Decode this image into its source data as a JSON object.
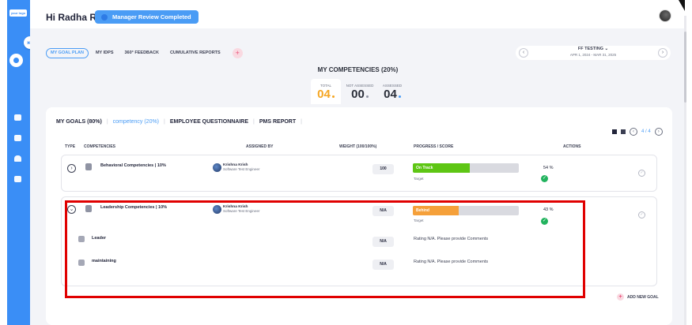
{
  "header": {
    "greeting": "Hi Radha R",
    "review_status": "Manager Review Completed"
  },
  "sidebar": {
    "logo_text": "your logo",
    "items": [
      {
        "icon": "dashboard-icon"
      },
      {
        "icon": "book-icon"
      },
      {
        "icon": "people-icon"
      },
      {
        "icon": "document-icon"
      }
    ]
  },
  "tabs": [
    {
      "label": "MY GOAL PLAN",
      "active": true
    },
    {
      "label": "MY IDPS",
      "active": false
    },
    {
      "label": "360° FEEDBACK",
      "active": false
    },
    {
      "label": "CUMULATIVE REPORTS",
      "active": false
    }
  ],
  "period": {
    "title": "FF TESTING ⌄",
    "range": "APR 1, 2024 - MAR 31, 2025"
  },
  "summary": {
    "title": "MY COMPETENCIES (20%)",
    "stats": [
      {
        "label": "TOTAL",
        "value": "04",
        "color": "#f5a623"
      },
      {
        "label": "NOT ASSESSED",
        "value": "00",
        "color": "#23263b"
      },
      {
        "label": "ASSESSED",
        "value": "04",
        "color": "#23263b"
      }
    ]
  },
  "goal_tabs": [
    {
      "label": "MY GOALS (80%)",
      "selected": false
    },
    {
      "label": "competency (20%)",
      "selected": true
    },
    {
      "label": "EMPLOYEE QUESTIONNAIRE",
      "selected": false
    },
    {
      "label": "PMS REPORT",
      "selected": false
    }
  ],
  "pager": "4 / 4",
  "columns": {
    "type": "TYPE",
    "competencies": "COMPETENCIES",
    "assigned_by": "ASSIGNED BY",
    "weight": "WEIGHT (100/100%)",
    "progress": "PROGRESS / SCORE",
    "actions": "ACTIONS"
  },
  "competencies": [
    {
      "title": "Behavioral Competencies | 10%",
      "assigned_name": "Krishna Krish",
      "assigned_role": "Software Test Engineer",
      "weight": "100",
      "status": "On Track",
      "status_color": "#5ec614",
      "progress": 0.54,
      "target": "Target",
      "score": "54 %"
    },
    {
      "title": "Leadership Competencies | 10%",
      "assigned_name": "Krishna Krish",
      "assigned_role": "Software Test Engineer",
      "weight": "N/A",
      "status": "Behind",
      "status_color": "#f5a03a",
      "progress": 0.43,
      "target": "Target",
      "score": "43 %",
      "sub_items": [
        {
          "title": "Leader",
          "weight": "N/A",
          "rating": "Rating N/A. Please provide Comments"
        },
        {
          "title": "maintaining",
          "weight": "N/A",
          "rating": "Rating N/A. Please provide Comments"
        }
      ]
    }
  ],
  "add_goal": "ADD NEW GOAL"
}
